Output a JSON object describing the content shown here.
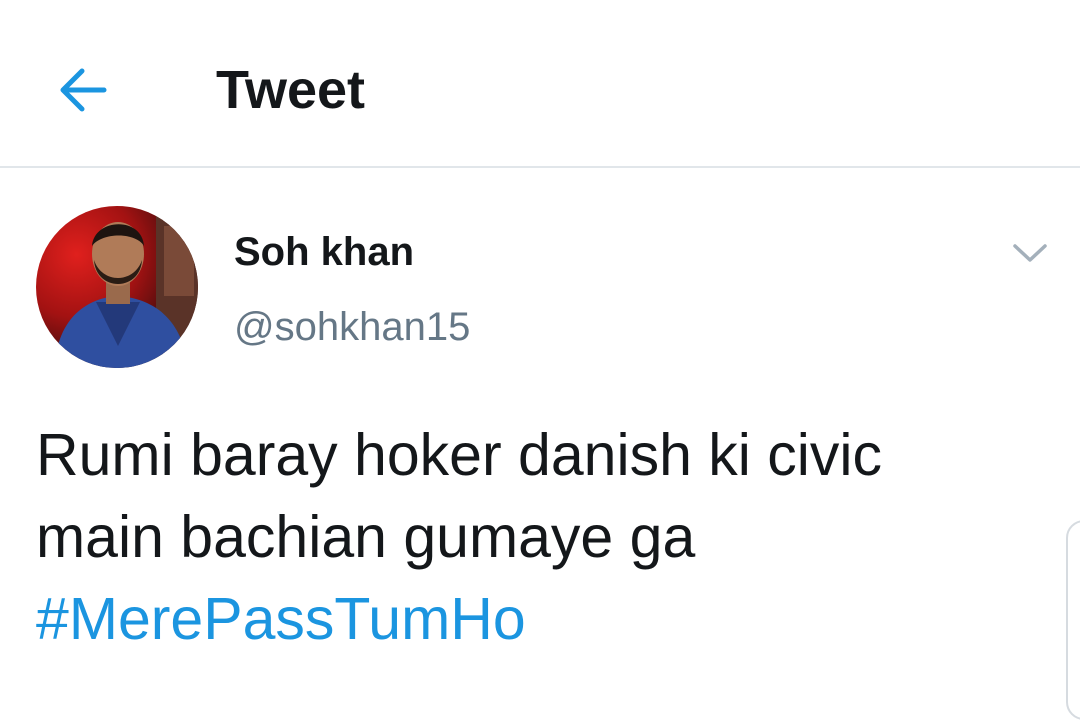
{
  "header": {
    "back_icon": "arrow-left-icon",
    "title": "Tweet"
  },
  "tweet": {
    "author": {
      "name": "Soh khan",
      "handle": "@sohkhan15",
      "avatar_icon": "avatar-photo"
    },
    "menu_icon": "chevron-down-icon",
    "text_lines": [
      "Rumi baray hoker danish ki civic",
      "main bachian gumaye ga"
    ],
    "hashtag": "#MerePassTumHo"
  },
  "colors": {
    "accent": "#1b95e0",
    "text_primary": "#14171a",
    "text_secondary": "#657786",
    "divider": "#e1e6ea"
  }
}
